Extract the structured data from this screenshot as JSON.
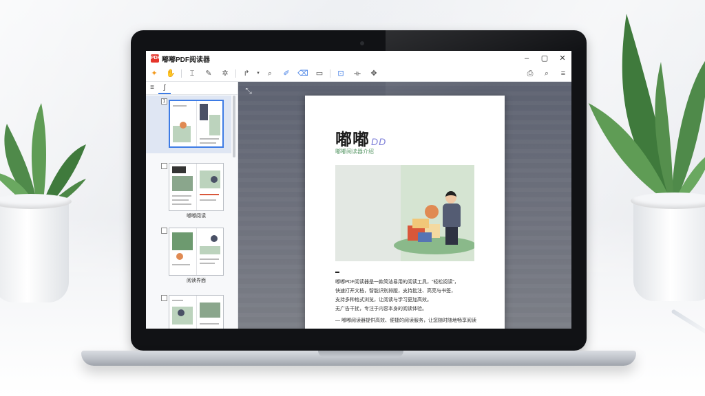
{
  "window": {
    "app_logo": "PDF",
    "title": "嘟嘟PDF阅读器",
    "controls": {
      "minimize": "–",
      "maximize": "▢",
      "close": "✕"
    }
  },
  "toolbar": {
    "left_icons": [
      "star-icon",
      "hand-icon",
      "select-text-icon",
      "annotate-icon",
      "cursor-icon",
      "rotate-icon",
      "dropdown-icon",
      "search-zoom-icon",
      "highlight-pen-icon",
      "eraser-icon",
      "view-mode-icon",
      "page-fit-icon",
      "fit-width-icon",
      "translate-icon"
    ],
    "right_icons": [
      "print-icon",
      "search-icon",
      "menu-icon"
    ]
  },
  "sidebar": {
    "tabs": [
      "≡",
      "ʃ"
    ],
    "thumbnails": [
      {
        "num": "1",
        "caption": "",
        "selected": true
      },
      {
        "num": "",
        "caption": "嘟嘟阅读",
        "selected": false
      },
      {
        "num": "",
        "caption": "阅读界面",
        "selected": false
      },
      {
        "num": "",
        "caption": "",
        "selected": false
      }
    ]
  },
  "document": {
    "title": "嘟嘟",
    "title_accent": "DD",
    "subtitle": "嘟嘟阅读器介绍",
    "paragraph_lines": [
      "嘟嘟PDF阅读器是一款简洁易用的阅读工具，“轻松阅读”，",
      "快速打开文档，智能识别排版，支持批注、高亮与书签，",
      "支持多种格式浏览，让阅读与学习更加高效。",
      "无广告干扰，专注于内容本身的阅读体验。"
    ],
    "paragraph2": "— 嘟嘟阅读器提供高效、便捷的阅读服务，让您随时随地畅享阅读"
  },
  "colors": {
    "accent": "#3d7be5",
    "logo": "#e5352b",
    "viewer_bg": "#6a6e7a"
  }
}
